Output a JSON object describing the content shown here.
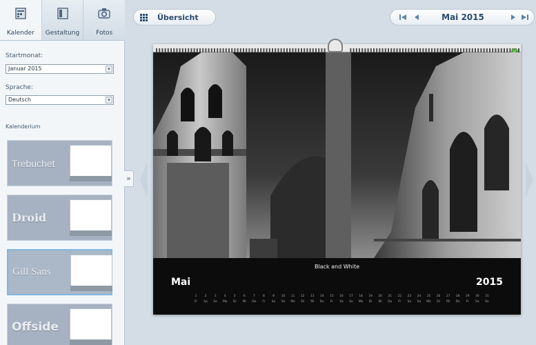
{
  "tabs": [
    {
      "label": "Kalender",
      "icon": "calendar-icon",
      "active": true
    },
    {
      "label": "Gestaltung",
      "icon": "layout-icon",
      "active": false
    },
    {
      "label": "Fotos",
      "icon": "camera-icon",
      "active": false
    }
  ],
  "form": {
    "start_month_label": "Startmonat:",
    "start_month_value": "Januar 2015",
    "language_label": "Sprache:",
    "language_value": "Deutsch",
    "theme_label": "Kalenderium"
  },
  "themes": [
    {
      "name": "Trebuchet",
      "selected": false
    },
    {
      "name": "Droid",
      "selected": false
    },
    {
      "name": "Gill Sans",
      "selected": true
    },
    {
      "name": "Offside",
      "selected": false
    }
  ],
  "toolbar": {
    "overview_label": "Übersicht",
    "current_month": "Mai 2015"
  },
  "calendar": {
    "caption": "Black and White",
    "month": "Mai",
    "year": "2015",
    "day_numbers": [
      "1",
      "2",
      "3",
      "4",
      "5",
      "6",
      "7",
      "8",
      "9",
      "10",
      "11",
      "12",
      "13",
      "14",
      "15",
      "16",
      "17",
      "18",
      "19",
      "20",
      "21",
      "22",
      "23",
      "24",
      "25",
      "26",
      "27",
      "28",
      "29",
      "30",
      "31"
    ],
    "weekday_labels": [
      "Fr",
      "Sa",
      "So",
      "Mo",
      "Di",
      "Mi",
      "Do",
      "Fr",
      "Sa",
      "So",
      "Mo",
      "Di",
      "Mi",
      "Do",
      "Fr",
      "Sa",
      "So",
      "Mo",
      "Di",
      "Mi",
      "Do",
      "Fr",
      "Sa",
      "So",
      "Mo",
      "Di",
      "Mi",
      "Do",
      "Fr",
      "Sa",
      "So"
    ]
  },
  "colors": {
    "accent": "#2c4b6c",
    "selection_border": "#7fb6e1",
    "ok_green": "#4fa53d"
  }
}
